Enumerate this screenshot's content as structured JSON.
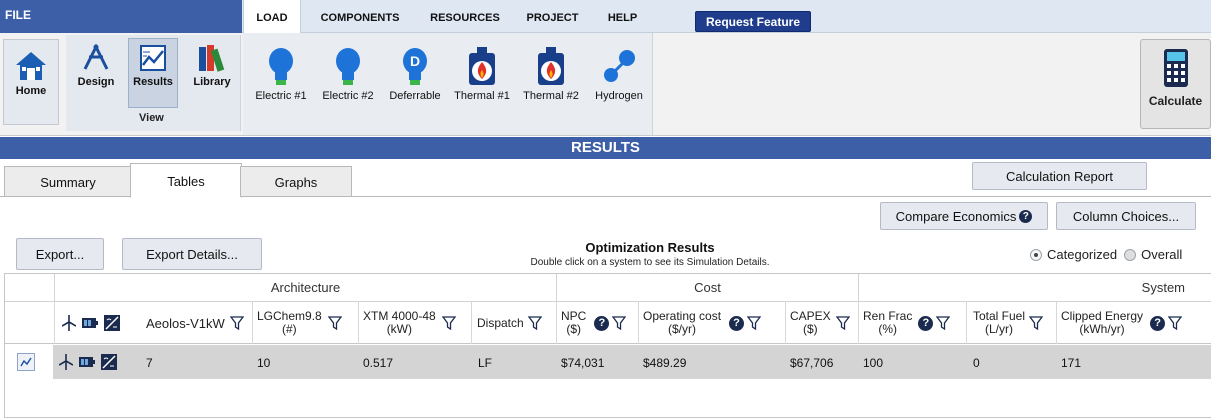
{
  "menu": {
    "file": "FILE",
    "tabs": [
      "LOAD",
      "COMPONENTS",
      "RESOURCES",
      "PROJECT",
      "HELP"
    ],
    "request_feature": "Request Feature"
  },
  "ribbon": {
    "home": "Home",
    "design": "Design",
    "results": "Results",
    "library": "Library",
    "view_group": "View",
    "loads": [
      "Electric #1",
      "Electric #2",
      "Deferrable",
      "Thermal #1",
      "Thermal #2",
      "Hydrogen"
    ],
    "calculate": "Calculate"
  },
  "results_header": "RESULTS",
  "subtabs": [
    "Summary",
    "Tables",
    "Graphs"
  ],
  "buttons": {
    "calculation_report": "Calculation Report",
    "compare_economics": "Compare Economics",
    "column_choices": "Column Choices...",
    "export": "Export...",
    "export_details": "Export Details..."
  },
  "optimization": {
    "title": "Optimization Results",
    "subtitle": "Double click on a system to see its Simulation Details.",
    "categorized": "Categorized",
    "overall": "Overall"
  },
  "table": {
    "groups": {
      "architecture": "Architecture",
      "cost": "Cost",
      "system": "System"
    },
    "columns": {
      "aeolos": "Aeolos-V1kW",
      "lgchem": "LGChem9.8\n(#)",
      "xtm": "XTM 4000-48\n(kW)",
      "dispatch": "Dispatch",
      "npc": "NPC\n($)",
      "opcost": "Operating cost\n($/yr)",
      "capex": "CAPEX\n($)",
      "renfrac": "Ren Frac\n(%)",
      "fuel": "Total Fuel\n(L/yr)",
      "clipped": "Clipped Energy\n(kWh/yr)"
    },
    "row": {
      "aeolos": "7",
      "lgchem": "10",
      "xtm": "0.517",
      "dispatch": "LF",
      "npc": "$74,031",
      "opcost": "$489.29",
      "capex": "$67,706",
      "renfrac": "100",
      "fuel": "0",
      "clipped": "171"
    }
  },
  "colors": {
    "brand_blue": "#3d5fa8",
    "request_btn": "#1f3d8c",
    "bulb_blue": "#1e73d9",
    "thermal_red": "#e0322b"
  }
}
